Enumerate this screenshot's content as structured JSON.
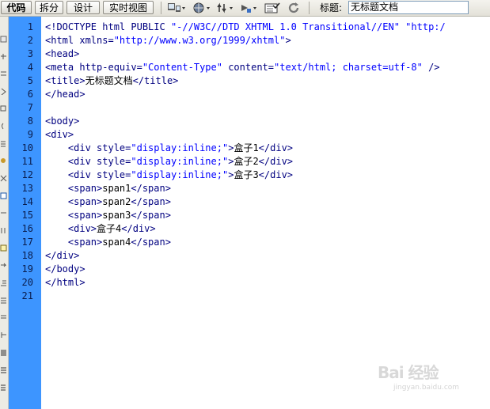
{
  "toolbar": {
    "view_buttons": [
      "代码",
      "拆分",
      "设计",
      "实时视图"
    ],
    "title_label": "标题:",
    "title_value": "无标题文档",
    "icons": [
      "multiscreen-icon",
      "preview-globe-icon",
      "file-management-icon",
      "debug-icon",
      "view-options-icon",
      "refresh-icon"
    ]
  },
  "side_toolbar": {
    "icons": [
      "open-documents-icon",
      "collapse-tag-icon",
      "collapse-selection-icon",
      "expand-all-icon",
      "select-parent-icon",
      "balance-braces-icon",
      "line-numbers-icon",
      "highlight-invalid-icon",
      "syntax-coloring-icon",
      "apply-comment-icon",
      "remove-comment-icon",
      "wrap-tag-icon",
      "recent-snippets-icon",
      "move-css-icon",
      "indent-icon",
      "outdent-icon",
      "format-source-icon"
    ]
  },
  "editor": {
    "lines": [
      [
        {
          "c": "a",
          "t": "<!DOCTYPE html PUBLIC "
        },
        {
          "c": "v",
          "t": "\"-//W3C//DTD XHTML 1.0 Transitional//EN\""
        },
        {
          "c": "a",
          "t": " "
        },
        {
          "c": "v",
          "t": "\"http:/"
        }
      ],
      [
        {
          "c": "a",
          "t": "<html xmlns="
        },
        {
          "c": "v",
          "t": "\"http://www.w3.org/1999/xhtml\""
        },
        {
          "c": "a",
          "t": ">"
        }
      ],
      [
        {
          "c": "a",
          "t": "<head>"
        }
      ],
      [
        {
          "c": "a",
          "t": "<meta http-equiv="
        },
        {
          "c": "v",
          "t": "\"Content-Type\""
        },
        {
          "c": "a",
          "t": " content="
        },
        {
          "c": "v",
          "t": "\"text/html; charset=utf-8\""
        },
        {
          "c": "a",
          "t": " />"
        }
      ],
      [
        {
          "c": "a",
          "t": "<title>"
        },
        {
          "c": "t",
          "t": "无标题文档"
        },
        {
          "c": "a",
          "t": "</title>"
        }
      ],
      [
        {
          "c": "a",
          "t": "</head>"
        }
      ],
      [],
      [
        {
          "c": "a",
          "t": "<body>"
        }
      ],
      [
        {
          "c": "a",
          "t": "<div>"
        }
      ],
      [
        {
          "c": "a",
          "t": "    <div style="
        },
        {
          "c": "v",
          "t": "\"display:inline;\""
        },
        {
          "c": "a",
          "t": ">"
        },
        {
          "c": "t",
          "t": "盒子1"
        },
        {
          "c": "a",
          "t": "</div>"
        }
      ],
      [
        {
          "c": "a",
          "t": "    <div style="
        },
        {
          "c": "v",
          "t": "\"display:inline;\""
        },
        {
          "c": "a",
          "t": ">"
        },
        {
          "c": "t",
          "t": "盒子2"
        },
        {
          "c": "a",
          "t": "</div>"
        }
      ],
      [
        {
          "c": "a",
          "t": "    <div style="
        },
        {
          "c": "v",
          "t": "\"display:inline;\""
        },
        {
          "c": "a",
          "t": ">"
        },
        {
          "c": "t",
          "t": "盒子3"
        },
        {
          "c": "a",
          "t": "</div>"
        }
      ],
      [
        {
          "c": "a",
          "t": "    <span>"
        },
        {
          "c": "t",
          "t": "span1"
        },
        {
          "c": "a",
          "t": "</span>"
        }
      ],
      [
        {
          "c": "a",
          "t": "    <span>"
        },
        {
          "c": "t",
          "t": "span2"
        },
        {
          "c": "a",
          "t": "</span>"
        }
      ],
      [
        {
          "c": "a",
          "t": "    <span>"
        },
        {
          "c": "t",
          "t": "span3"
        },
        {
          "c": "a",
          "t": "</span>"
        }
      ],
      [
        {
          "c": "a",
          "t": "    <div>"
        },
        {
          "c": "t",
          "t": "盒子4"
        },
        {
          "c": "a",
          "t": "</div>"
        }
      ],
      [
        {
          "c": "a",
          "t": "    <span>"
        },
        {
          "c": "t",
          "t": "span4"
        },
        {
          "c": "a",
          "t": "</span>"
        }
      ],
      [
        {
          "c": "a",
          "t": "</div>"
        }
      ],
      [
        {
          "c": "a",
          "t": "</body>"
        }
      ],
      [
        {
          "c": "a",
          "t": "</html>"
        }
      ],
      []
    ],
    "line_numbers": [
      "1",
      "2",
      "3",
      "4",
      "5",
      "6",
      "7",
      "8",
      "9",
      "10",
      "11",
      "12",
      "13",
      "14",
      "15",
      "16",
      "17",
      "18",
      "19",
      "20",
      "21"
    ],
    "colors": {
      "tag": "#000080",
      "value": "#0000ff",
      "text": "#000000",
      "gutter": "#3d95ff"
    }
  },
  "watermark": {
    "logo_text": "Bai 经验",
    "url": "jingyan.baidu.com"
  }
}
